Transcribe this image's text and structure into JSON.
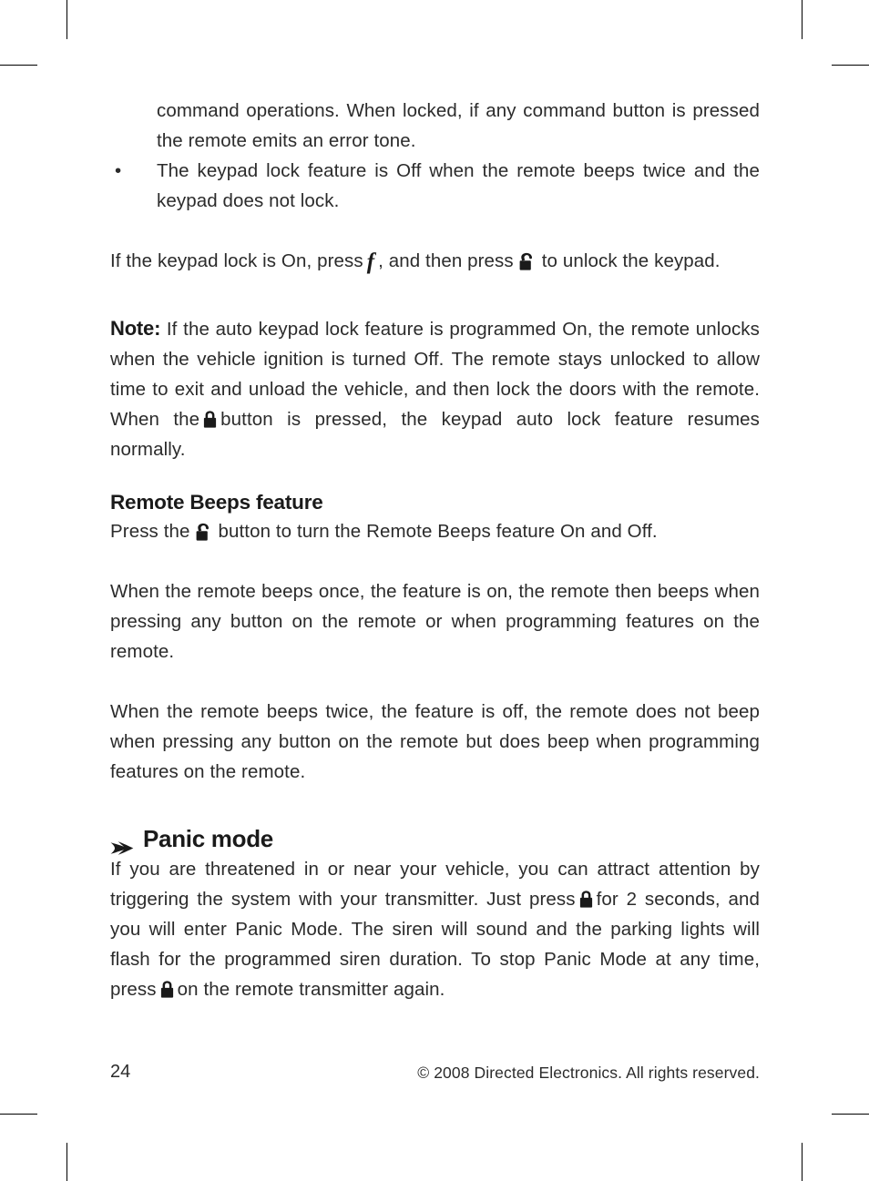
{
  "document": {
    "page_number": "24",
    "copyright": "© 2008 Directed Electronics. All rights reserved."
  },
  "icons": {
    "lock": "lock-closed-icon",
    "unlock": "lock-open-icon",
    "aux_f": "f",
    "section_arrow": "arrow-right-marker"
  },
  "content": {
    "continued_paragraph": "command operations. When locked, if any command button is pressed the remote emits an error tone.",
    "bullet_item": "The keypad lock feature is Off when the remote beeps twice and the keypad does not lock.",
    "bullet_glyph": "•",
    "unlock_instruction": {
      "part1": "If the keypad lock is On, press",
      "part2": ", and then press",
      "part3": "to unlock the keypad."
    },
    "note": {
      "label": "Note:",
      "part1": "If the auto keypad lock feature is programmed On, the remote unlocks when the vehicle ignition is turned Off. The remote stays unlocked to allow time to exit and unload the vehicle, and then lock the doors with the remote. When the",
      "part2": "button is pressed, the keypad auto lock feature resumes normally."
    },
    "remote_beeps": {
      "heading": "Remote Beeps feature",
      "press_part1": "Press the",
      "press_part2": "button to turn the Remote Beeps feature On and Off.",
      "paragraph_on": "When the remote beeps once, the feature is on, the remote then beeps when pressing any button on the remote or when programming features on the remote.",
      "paragraph_off": "When the remote beeps twice, the feature is off, the remote does not beep when pressing any button on the remote but does beep when programming features on the remote."
    },
    "panic_mode": {
      "heading": "Panic mode",
      "part1": "If you are threatened in or near your vehicle, you can attract attention by triggering the system with your transmitter. Just press",
      "part2": "for 2 seconds, and you will enter Panic Mode. The siren will sound and the parking lights will flash for the programmed siren duration. To stop Panic Mode at any time, press",
      "part3": "on the remote transmitter again."
    }
  },
  "colors": {
    "text": "#2b2b2b",
    "heading": "#1a1a1a",
    "background": "#ffffff",
    "crop_marks": "#000000"
  }
}
